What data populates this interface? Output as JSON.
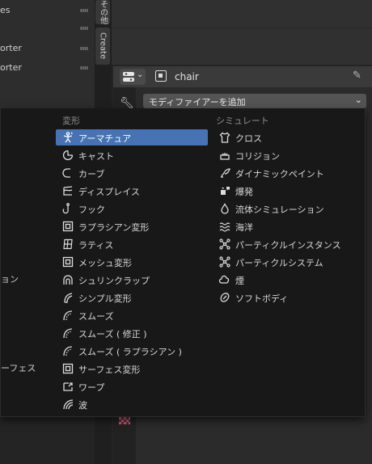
{
  "outliner": {
    "items": [
      "es",
      "",
      "orter",
      "orter"
    ]
  },
  "tabs": {
    "other": "その他",
    "create": "Create"
  },
  "properties": {
    "object_name": "chair",
    "add_modifier": "モディファイアーを追加"
  },
  "menu": {
    "left_stubs": [
      "ョン",
      "ーフェス"
    ],
    "deform": {
      "heading": "変形",
      "items": [
        {
          "label": "アーマチュア",
          "icon": "armature-icon",
          "highlight": true
        },
        {
          "label": "キャスト",
          "icon": "cast-icon"
        },
        {
          "label": "カーブ",
          "icon": "curve-icon"
        },
        {
          "label": "ディスプレイス",
          "icon": "displace-icon"
        },
        {
          "label": "フック",
          "icon": "hook-icon"
        },
        {
          "label": "ラプラシアン変形",
          "icon": "laplacian-deform-icon"
        },
        {
          "label": "ラティス",
          "icon": "lattice-icon"
        },
        {
          "label": "メッシュ変形",
          "icon": "mesh-deform-icon"
        },
        {
          "label": "シュリンクラップ",
          "icon": "shrinkwrap-icon"
        },
        {
          "label": "シンプル変形",
          "icon": "simple-deform-icon"
        },
        {
          "label": "スムーズ",
          "icon": "smooth-icon"
        },
        {
          "label": "スムーズ ( 修正 )",
          "icon": "smooth-corrective-icon"
        },
        {
          "label": "スムーズ ( ラプラシアン )",
          "icon": "smooth-laplacian-icon"
        },
        {
          "label": "サーフェス変形",
          "icon": "surface-deform-icon"
        },
        {
          "label": "ワープ",
          "icon": "warp-icon"
        },
        {
          "label": "波",
          "icon": "wave-icon"
        }
      ]
    },
    "simulate": {
      "heading": "シミュレート",
      "items": [
        {
          "label": "クロス",
          "icon": "cloth-icon"
        },
        {
          "label": "コリジョン",
          "icon": "collision-icon"
        },
        {
          "label": "ダイナミックペイント",
          "icon": "dynamic-paint-icon"
        },
        {
          "label": "爆発",
          "icon": "explode-icon"
        },
        {
          "label": "流体シミュレーション",
          "icon": "fluid-icon"
        },
        {
          "label": "海洋",
          "icon": "ocean-icon"
        },
        {
          "label": "パーティクルインスタンス",
          "icon": "particle-instance-icon"
        },
        {
          "label": "パーティクルシステム",
          "icon": "particle-system-icon"
        },
        {
          "label": "煙",
          "icon": "smoke-icon"
        },
        {
          "label": "ソフトボディ",
          "icon": "soft-body-icon"
        }
      ]
    }
  },
  "colors": {
    "highlight": "#4772b3",
    "menu_bg": "#181818"
  }
}
